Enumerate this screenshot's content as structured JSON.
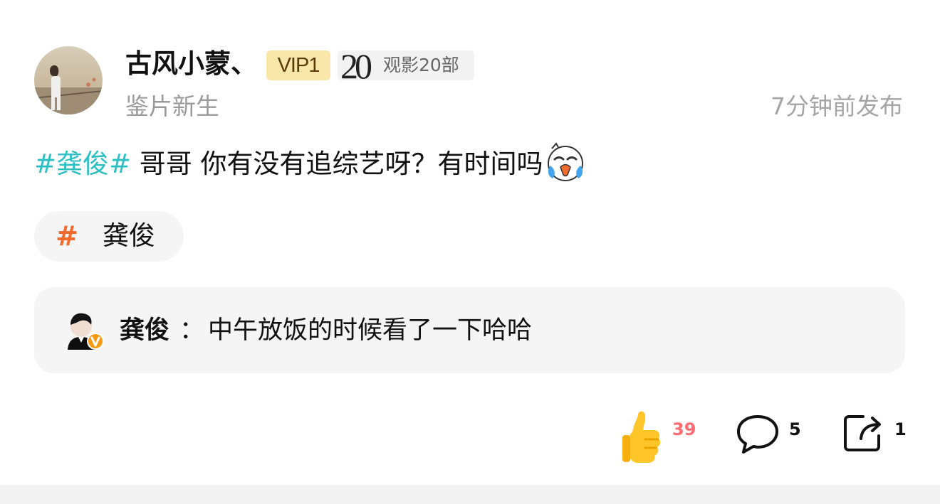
{
  "user": {
    "name": "古风小蒙、",
    "vip_label": "VIP1",
    "watch_count_display": "20",
    "watch_count_text": "观影20部",
    "level_title": "鉴片新生",
    "avatar_icon": "traveler-avatar-icon"
  },
  "post": {
    "time": "7分钟前发布",
    "hashtag": "#龚俊#",
    "text": " 哥哥 你有没有追综艺呀？有时间吗",
    "emoji_icon": "crying-face-icon",
    "topic_chip": {
      "icon": "hash-icon",
      "label": "龚俊"
    }
  },
  "reply": {
    "author": "龚俊",
    "colon": "：",
    "text": "中午放饭的时候看了一下哈哈",
    "avatar_icon": "verified-avatar-icon"
  },
  "actions": {
    "like": {
      "icon": "thumbs-up-icon",
      "count": "39"
    },
    "comment": {
      "icon": "comment-bubble-icon",
      "count": "5"
    },
    "share": {
      "icon": "share-icon",
      "count": "1"
    }
  },
  "colors": {
    "hashtag": "#2bbfc4",
    "topic_hash": "#f46a2c",
    "like_count": "#ff6b72",
    "vip_badge": "#f8e7a8"
  }
}
